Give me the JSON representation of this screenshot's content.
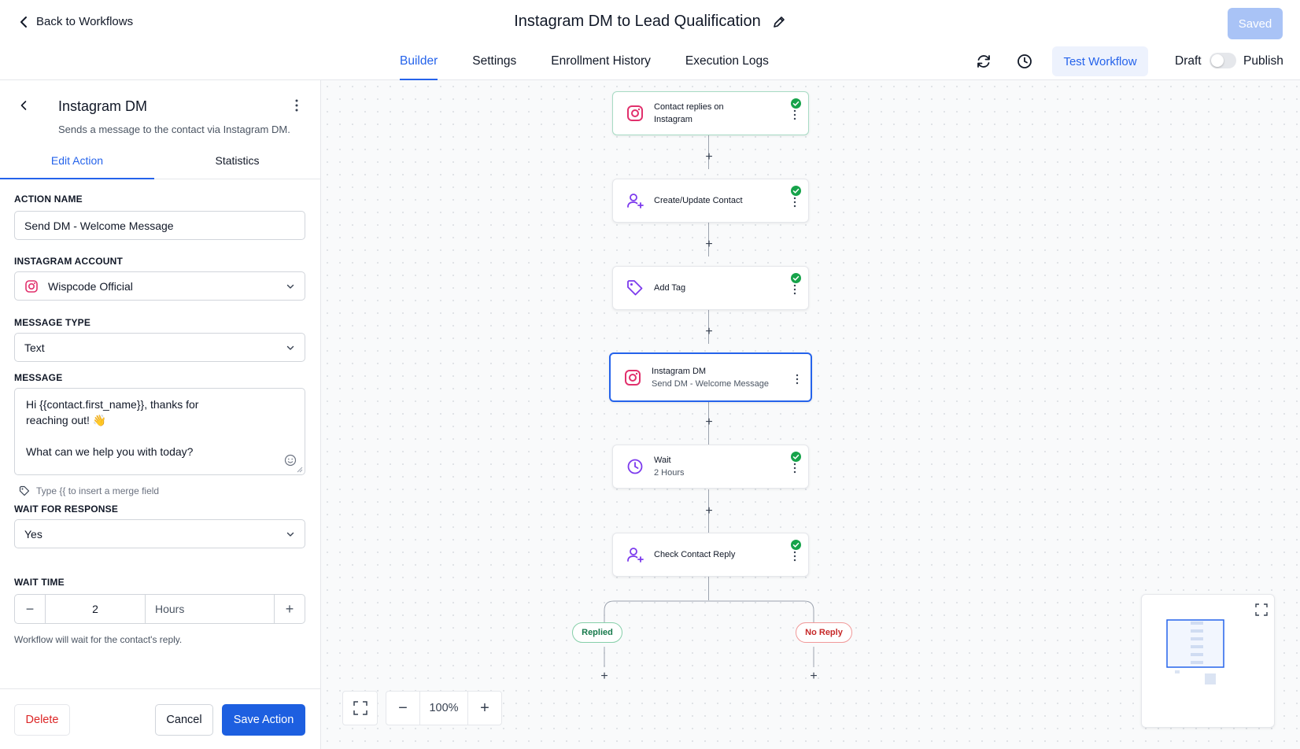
{
  "header": {
    "back_label": "Back to Workflows",
    "title": "Instagram DM to Lead Qualification",
    "saved_label": "Saved",
    "tabs": [
      {
        "label": "Builder",
        "active": true
      },
      {
        "label": "Settings",
        "active": false
      },
      {
        "label": "Enrollment History",
        "active": false
      },
      {
        "label": "Execution Logs",
        "active": false
      }
    ],
    "test_label": "Test Workflow",
    "draft_label": "Draft",
    "publish_label": "Publish",
    "publish_toggle_on": false
  },
  "panel": {
    "title": "Instagram DM",
    "description": "Sends a message to the contact via Instagram DM.",
    "tabs": [
      {
        "label": "Edit Action",
        "active": true
      },
      {
        "label": "Statistics",
        "active": false
      }
    ],
    "action_name": {
      "label": "ACTION NAME",
      "value": "Send DM - Welcome Message"
    },
    "instagram_account": {
      "label": "INSTAGRAM ACCOUNT",
      "value": "Wispcode Official"
    },
    "message_type": {
      "label": "MESSAGE TYPE",
      "value": "Text"
    },
    "message": {
      "label": "MESSAGE",
      "lines": [
        "Hi {{contact.first_name}}, thanks for",
        "reaching out! 👋",
        "",
        "What can we help you with today?"
      ]
    },
    "merge_hint": "Type {{ to insert a merge field",
    "wait_for_response": {
      "label": "WAIT FOR RESPONSE",
      "value": "Yes"
    },
    "wait_time": {
      "label": "WAIT TIME",
      "value": "2",
      "unit": "Hours"
    },
    "wait_note": "Workflow will wait for the contact's reply.",
    "buttons": {
      "delete": "Delete",
      "cancel": "Cancel",
      "save": "Save Action"
    }
  },
  "canvas": {
    "nodes": [
      {
        "title": "Contact replies on",
        "title2": "Instagram",
        "icon": "instagram-icon",
        "status": "complete"
      },
      {
        "title": "Create/Update Contact",
        "icon": "user-plus-icon",
        "status": "complete"
      },
      {
        "title": "Add Tag",
        "icon": "tag-icon",
        "status": "complete"
      },
      {
        "title": "Instagram DM",
        "subtitle": "Send DM - Welcome Message",
        "icon": "instagram-icon",
        "status": "selected"
      },
      {
        "title": "Wait",
        "subtitle": "2 Hours",
        "icon": "clock-icon",
        "status": "complete"
      },
      {
        "title": "Check Contact Reply",
        "icon": "user-plus-icon",
        "status": "complete"
      }
    ],
    "branches": [
      {
        "label": "Replied",
        "color": "#16794b"
      },
      {
        "label": "No Reply",
        "color": "#c62828"
      }
    ],
    "zoom": "100%"
  },
  "colors": {
    "accent": "#2563eb",
    "instagram": "#e1306c",
    "icon_purple": "#7c3aed",
    "success": "#16a34a",
    "danger": "#dc2626"
  }
}
